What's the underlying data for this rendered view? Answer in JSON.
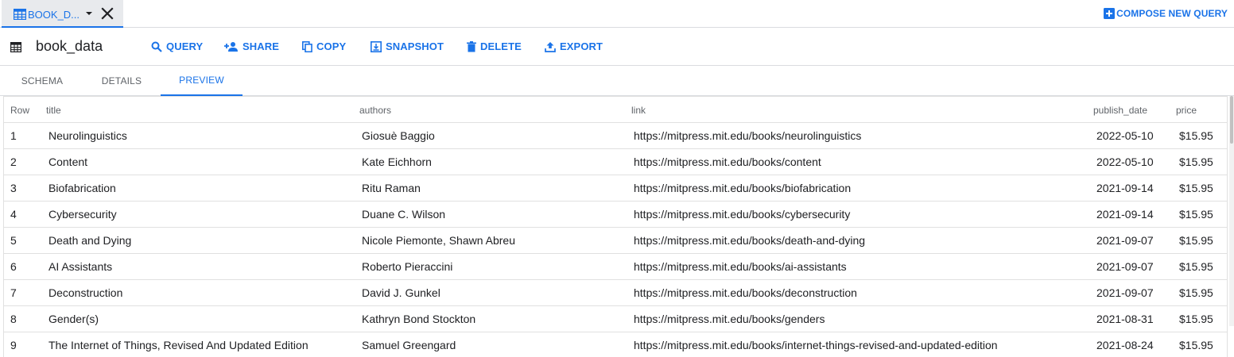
{
  "tab": {
    "title": "BOOK_D..."
  },
  "compose_label": "COMPOSE NEW QUERY",
  "dataset_name": "book_data",
  "toolbar": {
    "query": "QUERY",
    "share": "SHARE",
    "copy": "COPY",
    "snapshot": "SNAPSHOT",
    "delete": "DELETE",
    "export": "EXPORT"
  },
  "subtabs": {
    "schema": "SCHEMA",
    "details": "DETAILS",
    "preview": "PREVIEW"
  },
  "colors": {
    "accent": "#1a73e8",
    "text": "#202124",
    "muted": "#5f6368",
    "border": "#e0e0e0"
  },
  "table": {
    "headers": {
      "row": "Row",
      "title": "title",
      "authors": "authors",
      "link": "link",
      "publish_date": "publish_date",
      "price": "price"
    },
    "rows": [
      {
        "row": "1",
        "title": "Neurolinguistics",
        "authors": "Giosuè Baggio",
        "link": "https://mitpress.mit.edu/books/neurolinguistics",
        "publish_date": "2022-05-10",
        "price": "$15.95"
      },
      {
        "row": "2",
        "title": "Content",
        "authors": "Kate Eichhorn",
        "link": "https://mitpress.mit.edu/books/content",
        "publish_date": "2022-05-10",
        "price": "$15.95"
      },
      {
        "row": "3",
        "title": "Biofabrication",
        "authors": "Ritu Raman",
        "link": "https://mitpress.mit.edu/books/biofabrication",
        "publish_date": "2021-09-14",
        "price": "$15.95"
      },
      {
        "row": "4",
        "title": "Cybersecurity",
        "authors": "Duane C. Wilson",
        "link": "https://mitpress.mit.edu/books/cybersecurity",
        "publish_date": "2021-09-14",
        "price": "$15.95"
      },
      {
        "row": "5",
        "title": "Death and Dying",
        "authors": "Nicole Piemonte, Shawn Abreu",
        "link": "https://mitpress.mit.edu/books/death-and-dying",
        "publish_date": "2021-09-07",
        "price": "$15.95"
      },
      {
        "row": "6",
        "title": "AI Assistants",
        "authors": "Roberto Pieraccini",
        "link": "https://mitpress.mit.edu/books/ai-assistants",
        "publish_date": "2021-09-07",
        "price": "$15.95"
      },
      {
        "row": "7",
        "title": "Deconstruction",
        "authors": "David J. Gunkel",
        "link": "https://mitpress.mit.edu/books/deconstruction",
        "publish_date": "2021-09-07",
        "price": "$15.95"
      },
      {
        "row": "8",
        "title": "Gender(s)",
        "authors": "Kathryn Bond Stockton",
        "link": "https://mitpress.mit.edu/books/genders",
        "publish_date": "2021-08-31",
        "price": "$15.95"
      },
      {
        "row": "9",
        "title": "The Internet of Things, Revised And Updated Edition",
        "authors": "Samuel Greengard",
        "link": "https://mitpress.mit.edu/books/internet-things-revised-and-updated-edition",
        "publish_date": "2021-08-24",
        "price": "$15.95"
      }
    ]
  }
}
